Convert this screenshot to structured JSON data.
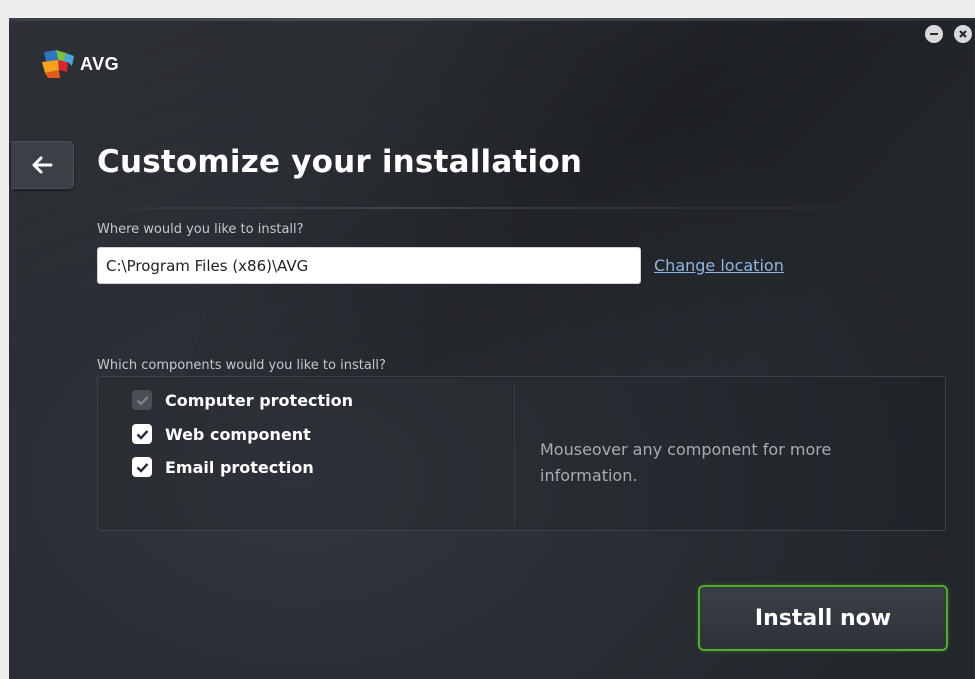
{
  "app": {
    "brand": "AVG"
  },
  "window_controls": {
    "minimize_icon": "minus-icon",
    "close_icon": "close-icon"
  },
  "header": {
    "back_icon": "arrow-left-icon",
    "title": "Customize your installation"
  },
  "install_location": {
    "label": "Where would you like to install?",
    "path_value": "C:\\Program Files (x86)\\AVG",
    "change_link": "Change location"
  },
  "components": {
    "label": "Which components would you like to install?",
    "items": [
      {
        "label": "Computer protection",
        "checked": true,
        "disabled": true
      },
      {
        "label": "Web component",
        "checked": true,
        "disabled": false
      },
      {
        "label": "Email protection",
        "checked": true,
        "disabled": false
      }
    ],
    "info_text": "Mouseover any component for more information."
  },
  "footer": {
    "install_button": "Install now"
  },
  "colors": {
    "background": "#262a30",
    "accent_green": "#4fae2f",
    "link": "#8fb7e4"
  }
}
